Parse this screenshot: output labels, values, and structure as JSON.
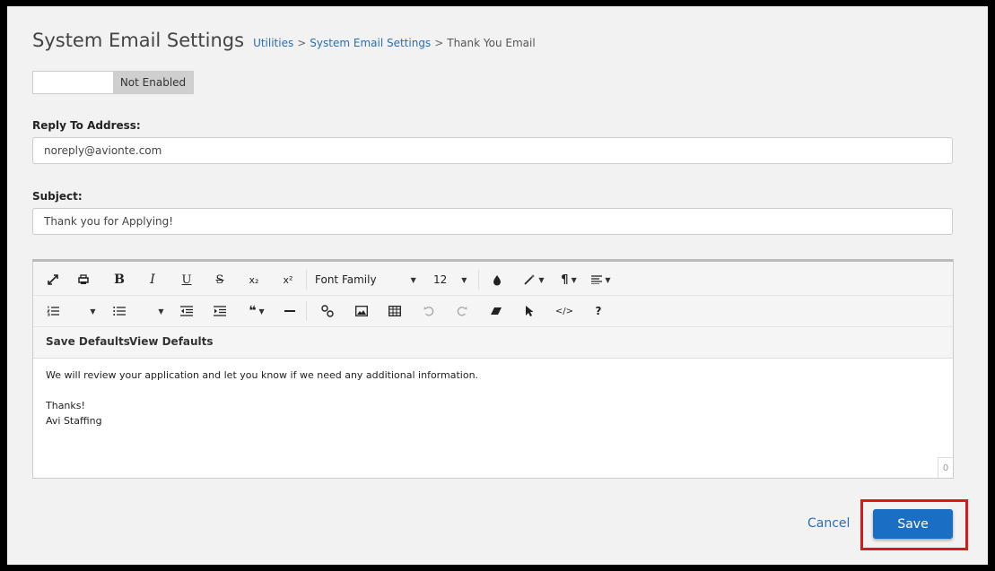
{
  "header": {
    "title": "System Email Settings",
    "breadcrumb": [
      "Utilities",
      "System Email Settings",
      "Thank You Email"
    ],
    "separator": ">"
  },
  "toggle": {
    "state_label": "Not Enabled",
    "enabled": false
  },
  "reply_to": {
    "label": "Reply To Address:",
    "value": "noreply@avionte.com"
  },
  "subject": {
    "label": "Subject:",
    "value": "Thank you for Applying!"
  },
  "editor": {
    "font_family_label": "Font Family",
    "font_size": "12",
    "save_defaults": "Save Defaults",
    "view_defaults": "View Defaults",
    "body_lines": [
      "We will review your application and let you know if we need any additional information.",
      "",
      "Thanks!",
      "Avi Staffing"
    ],
    "char_count": "0",
    "icons": {
      "bold": "B",
      "italic": "I",
      "underline": "U",
      "strike": "S",
      "sub": "x₂",
      "sup": "x²",
      "paragraph": "¶",
      "help": "?",
      "code": "</>"
    }
  },
  "actions": {
    "cancel": "Cancel",
    "save": "Save"
  },
  "colors": {
    "accent": "#1a6fc4",
    "link": "#2a6eb5",
    "highlight": "#d71a1a"
  }
}
